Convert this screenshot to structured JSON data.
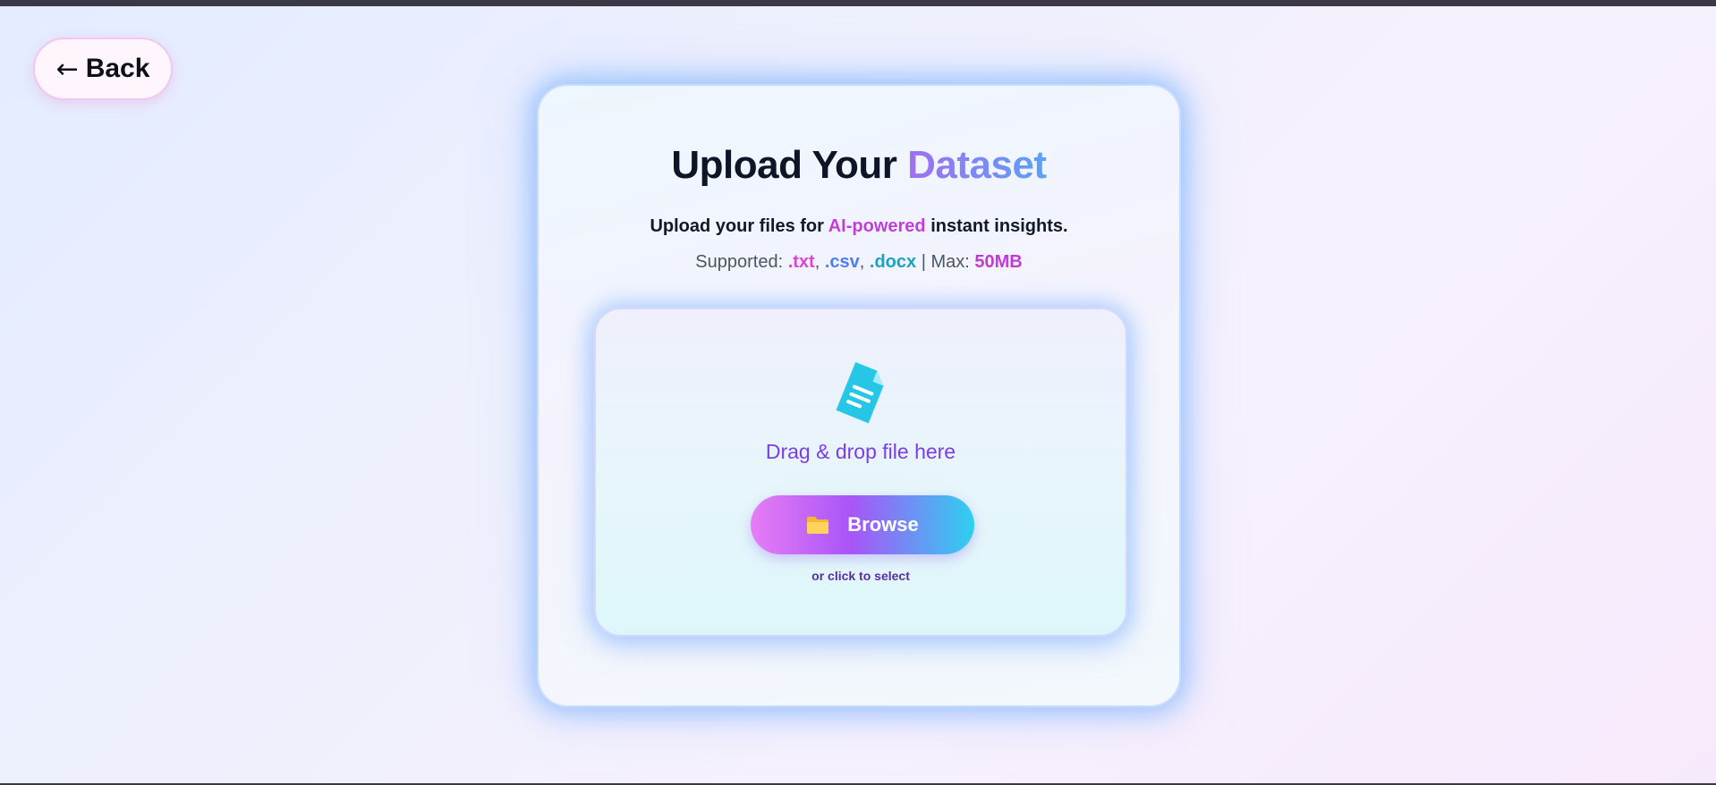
{
  "nav": {
    "back_arrow": "←",
    "back_label": "Back"
  },
  "card": {
    "title_main": "Upload Your ",
    "title_accent": "Dataset",
    "subtitle_pre": "Upload your files for ",
    "subtitle_highlight": "AI-powered",
    "subtitle_post": " instant insights.",
    "supported_label": "Supported: ",
    "ext_txt": ".txt",
    "sep1": ", ",
    "ext_csv": ".csv",
    "sep2": ", ",
    "ext_docx": ".docx",
    "max_label": " | Max: ",
    "max_value": "50MB"
  },
  "dropzone": {
    "icon": "document-icon",
    "drag_text": "Drag & drop file here",
    "browse_icon": "folder-icon",
    "browse_label": "Browse",
    "click_text": "or click to select"
  },
  "colors": {
    "accent_purple": "#7b3ee6",
    "accent_pink": "#c23ed9",
    "accent_cyan": "#2ed0f0",
    "accent_blue": "#4f7df0"
  }
}
